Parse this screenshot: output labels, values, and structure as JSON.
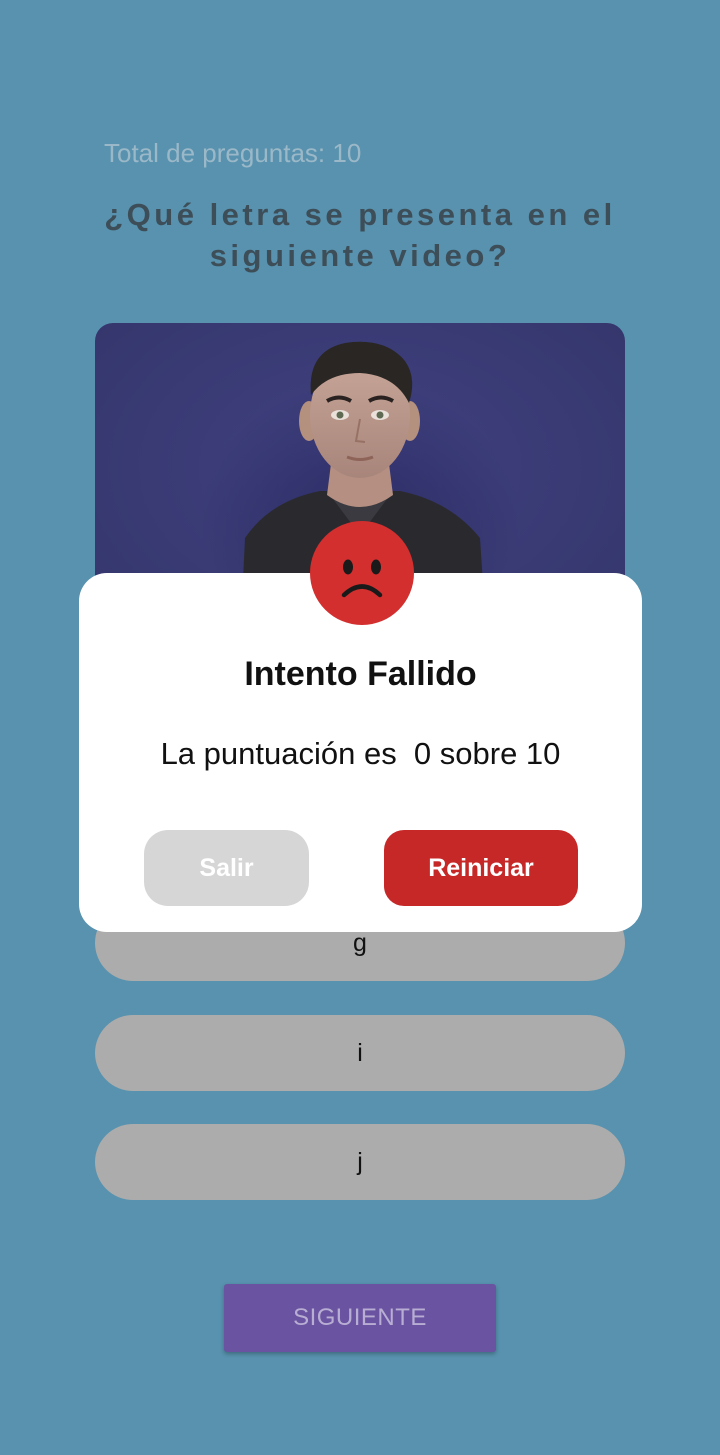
{
  "quiz": {
    "total_label": "Total de preguntas: 10",
    "question": "¿Qué letra se presenta en el siguiente video?",
    "answers": [
      "g",
      "i",
      "j"
    ],
    "next_label": "SIGUIENTE"
  },
  "dialog": {
    "icon": "sad-face-icon",
    "title": "Intento Fallido",
    "message": "La puntuación es  0 sobre 10",
    "exit_label": "Salir",
    "restart_label": "Reiniciar"
  },
  "colors": {
    "background": "#5892ae",
    "answer_bg": "#acacac",
    "next_button": "#6a53a0",
    "restart_button": "#c62828",
    "exit_button": "#d6d6d6",
    "sad_face": "#d32f2f",
    "video_bg": "#3a3b75"
  }
}
